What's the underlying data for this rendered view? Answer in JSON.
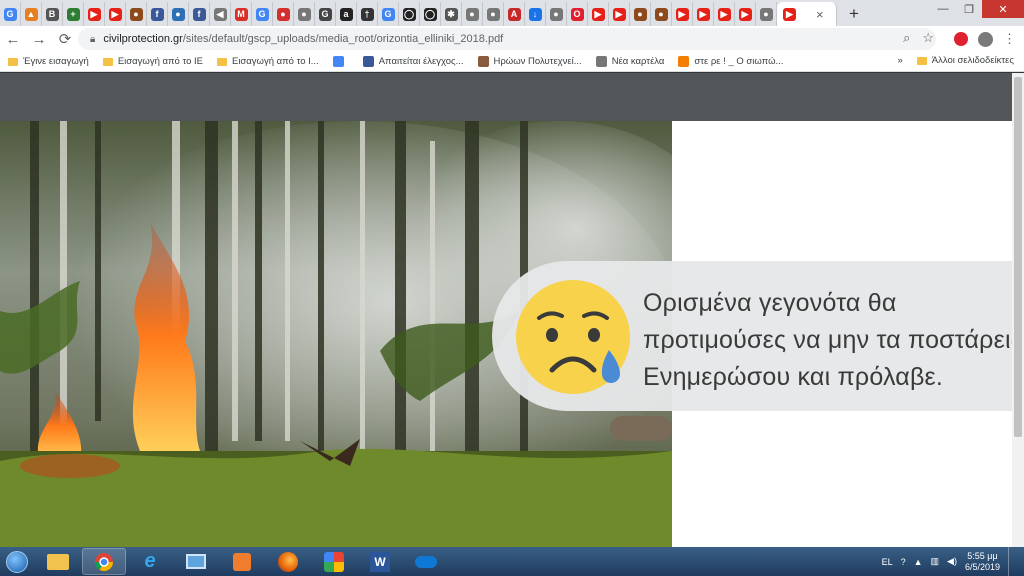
{
  "browser": {
    "tabs": [
      {
        "icon": "google-icon",
        "color": "#4285f4",
        "glyph": "G"
      },
      {
        "icon": "warning-icon",
        "color": "#e67e22",
        "glyph": "▲"
      },
      {
        "icon": "b-icon",
        "color": "#555555",
        "glyph": "B"
      },
      {
        "icon": "plus-icon",
        "color": "#2e7d32",
        "glyph": "+"
      },
      {
        "icon": "youtube-icon",
        "color": "#e62117",
        "glyph": "▶"
      },
      {
        "icon": "youtube-icon",
        "color": "#e62117",
        "glyph": "▶"
      },
      {
        "icon": "civil-protection-icon",
        "color": "#8d4a1c",
        "glyph": "●"
      },
      {
        "icon": "facebook-icon",
        "color": "#3b5998",
        "glyph": "f"
      },
      {
        "icon": "globe-icon",
        "color": "#2f6fb5",
        "glyph": "●"
      },
      {
        "icon": "facebook-icon",
        "color": "#3b5998",
        "glyph": "f"
      },
      {
        "icon": "speaker-icon",
        "color": "#777777",
        "glyph": "◀"
      },
      {
        "icon": "gmail-icon",
        "color": "#d93025",
        "glyph": "M"
      },
      {
        "icon": "google-icon",
        "color": "#4285f4",
        "glyph": "G"
      },
      {
        "icon": "red-circle-icon",
        "color": "#d32f2f",
        "glyph": "●"
      },
      {
        "icon": "chrome-icon",
        "color": "#777777",
        "glyph": "●"
      },
      {
        "icon": "g-icon",
        "color": "#444444",
        "glyph": "G"
      },
      {
        "icon": "amazon-icon",
        "color": "#222222",
        "glyph": "a"
      },
      {
        "icon": "dagger-icon",
        "color": "#333333",
        "glyph": "†"
      },
      {
        "icon": "google-icon",
        "color": "#4285f4",
        "glyph": "G"
      },
      {
        "icon": "github-icon",
        "color": "#222222",
        "glyph": "◯"
      },
      {
        "icon": "github-icon",
        "color": "#222222",
        "glyph": "◯"
      },
      {
        "icon": "puzzle-icon",
        "color": "#555555",
        "glyph": "✱"
      },
      {
        "icon": "chrome-icon",
        "color": "#777777",
        "glyph": "●"
      },
      {
        "icon": "chrome-icon",
        "color": "#777777",
        "glyph": "●"
      },
      {
        "icon": "news-icon",
        "color": "#c62828",
        "glyph": "A"
      },
      {
        "icon": "download-icon",
        "color": "#1a73e8",
        "glyph": "↓"
      },
      {
        "icon": "chrome-icon",
        "color": "#777777",
        "glyph": "●"
      },
      {
        "icon": "opera-icon",
        "color": "#e0202f",
        "glyph": "O"
      },
      {
        "icon": "youtube-icon",
        "color": "#e62117",
        "glyph": "▶"
      },
      {
        "icon": "youtube-icon",
        "color": "#e62117",
        "glyph": "▶"
      },
      {
        "icon": "civil-protection-icon",
        "color": "#8d4a1c",
        "glyph": "●"
      },
      {
        "icon": "civil-protection-icon",
        "color": "#8d4a1c",
        "glyph": "●"
      },
      {
        "icon": "youtube-icon",
        "color": "#e62117",
        "glyph": "▶"
      },
      {
        "icon": "youtube-icon",
        "color": "#e62117",
        "glyph": "▶"
      },
      {
        "icon": "youtube-icon",
        "color": "#e62117",
        "glyph": "▶"
      },
      {
        "icon": "youtube-icon",
        "color": "#e62117",
        "glyph": "▶"
      },
      {
        "icon": "chrome-icon",
        "color": "#777777",
        "glyph": "●"
      },
      {
        "icon": "youtube-icon",
        "color": "#e62117",
        "glyph": "▶"
      }
    ],
    "active_tab_close": "×",
    "new_tab": "+",
    "window_controls": {
      "minimize": "—",
      "maximize": "❐",
      "close": "✕"
    },
    "url_host": "civilprotection.gr",
    "url_path": "/sites/default/gscp_uploads/media_root/orizontia_elliniki_2018.pdf",
    "bookmarks": [
      {
        "label": "Έγινε εισαγωγή",
        "icon": "folder-icon"
      },
      {
        "label": "Εισαγωγή από το IE",
        "icon": "folder-icon"
      },
      {
        "label": "Εισαγωγή από το I...",
        "icon": "folder-icon"
      },
      {
        "label": "",
        "icon": "google-icon"
      },
      {
        "label": "Απαιτείται έλεγχος...",
        "icon": "facebook-icon"
      },
      {
        "label": "Ηρώων Πολυτεχνεί...",
        "icon": "photo-icon"
      },
      {
        "label": "Νέα καρτέλα",
        "icon": "chrome-icon"
      },
      {
        "label": "στε ρε ! _ Ο σιωπώ...",
        "icon": "blogger-icon"
      }
    ],
    "bookmarks_overflow": "»",
    "other_bookmarks": "Άλλοι σελιδοδείκτες"
  },
  "pdf": {
    "message_lines": [
      "Ορισμένα γεγονότα θα",
      "προτιμούσες να μην τα ποστάρεις.",
      "Ενημερώσου και πρόλαβε."
    ]
  },
  "taskbar": {
    "language": "EL",
    "time": "5:55 μμ",
    "date": "6/5/2019"
  }
}
